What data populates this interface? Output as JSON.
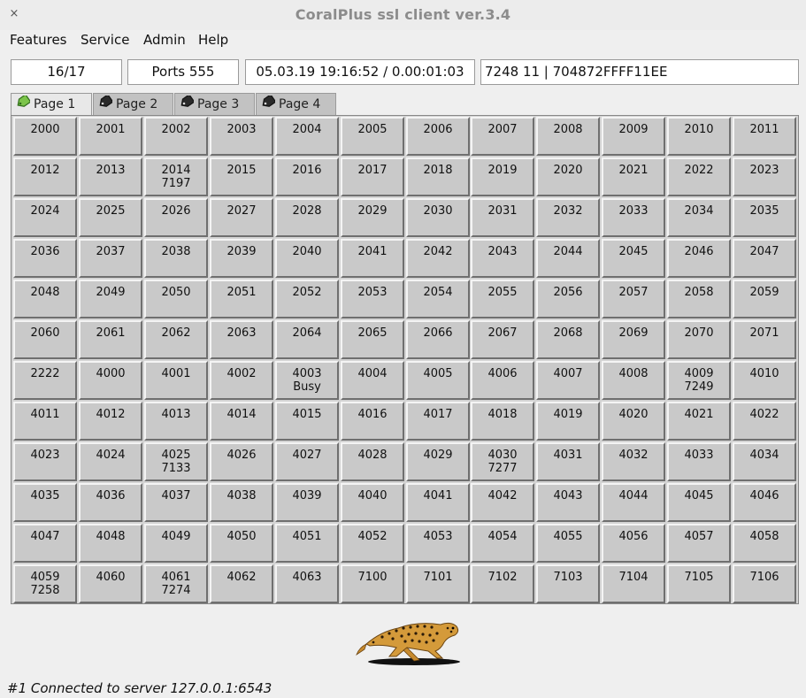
{
  "window": {
    "title": "CoralPlus ssl client ver.3.4",
    "close_glyph": "×"
  },
  "menu": [
    "Features",
    "Service",
    "Admin",
    "Help"
  ],
  "info": {
    "count": "16/17",
    "ports": "Ports 555",
    "datetime": "05.03.19 19:16:52 / 0.00:01:03",
    "id": "7248 11 | 704872FFFF11EE"
  },
  "tabs": [
    {
      "label": "Page 1",
      "icon": "tag-icon",
      "active": true
    },
    {
      "label": "Page 2",
      "icon": "tag-icon",
      "active": false
    },
    {
      "label": "Page 3",
      "icon": "tag-icon",
      "active": false
    },
    {
      "label": "Page 4",
      "icon": "tag-icon",
      "active": false
    }
  ],
  "ports": [
    [
      "2000",
      "2001",
      "2002",
      "2003",
      "2004",
      "2005",
      "2006",
      "2007",
      "2008",
      "2009",
      "2010",
      "2011"
    ],
    [
      "2012",
      "2013",
      "2014|7197",
      "2015",
      "2016",
      "2017",
      "2018",
      "2019",
      "2020",
      "2021",
      "2022",
      "2023"
    ],
    [
      "2024",
      "2025",
      "2026",
      "2027",
      "2028",
      "2029",
      "2030",
      "2031",
      "2032",
      "2033",
      "2034",
      "2035"
    ],
    [
      "2036",
      "2037",
      "2038",
      "2039",
      "2040",
      "2041",
      "2042",
      "2043",
      "2044",
      "2045",
      "2046",
      "2047"
    ],
    [
      "2048",
      "2049",
      "2050",
      "2051",
      "2052",
      "2053",
      "2054",
      "2055",
      "2056",
      "2057",
      "2058",
      "2059"
    ],
    [
      "2060",
      "2061",
      "2062",
      "2063",
      "2064",
      "2065",
      "2066",
      "2067",
      "2068",
      "2069",
      "2070",
      "2071"
    ],
    [
      "2222",
      "4000",
      "4001",
      "4002",
      "4003|Busy",
      "4004",
      "4005",
      "4006",
      "4007",
      "4008",
      "4009|7249",
      "4010"
    ],
    [
      "4011",
      "4012",
      "4013",
      "4014",
      "4015",
      "4016",
      "4017",
      "4018",
      "4019",
      "4020",
      "4021",
      "4022"
    ],
    [
      "4023",
      "4024",
      "4025|7133",
      "4026",
      "4027",
      "4028",
      "4029",
      "4030|7277",
      "4031",
      "4032",
      "4033",
      "4034"
    ],
    [
      "4035",
      "4036",
      "4037",
      "4038",
      "4039",
      "4040",
      "4041",
      "4042",
      "4043",
      "4044",
      "4045",
      "4046"
    ],
    [
      "4047",
      "4048",
      "4049",
      "4050",
      "4051",
      "4052",
      "4053",
      "4054",
      "4055",
      "4056",
      "4057",
      "4058"
    ],
    [
      "4059|7258",
      "4060",
      "4061|7274",
      "4062",
      "4063",
      "7100",
      "7101",
      "7102",
      "7103",
      "7104",
      "7105",
      "7106"
    ]
  ],
  "logo": {
    "icon": "cheetah-icon"
  },
  "status": "#1 Connected to server 127.0.0.1:6543"
}
